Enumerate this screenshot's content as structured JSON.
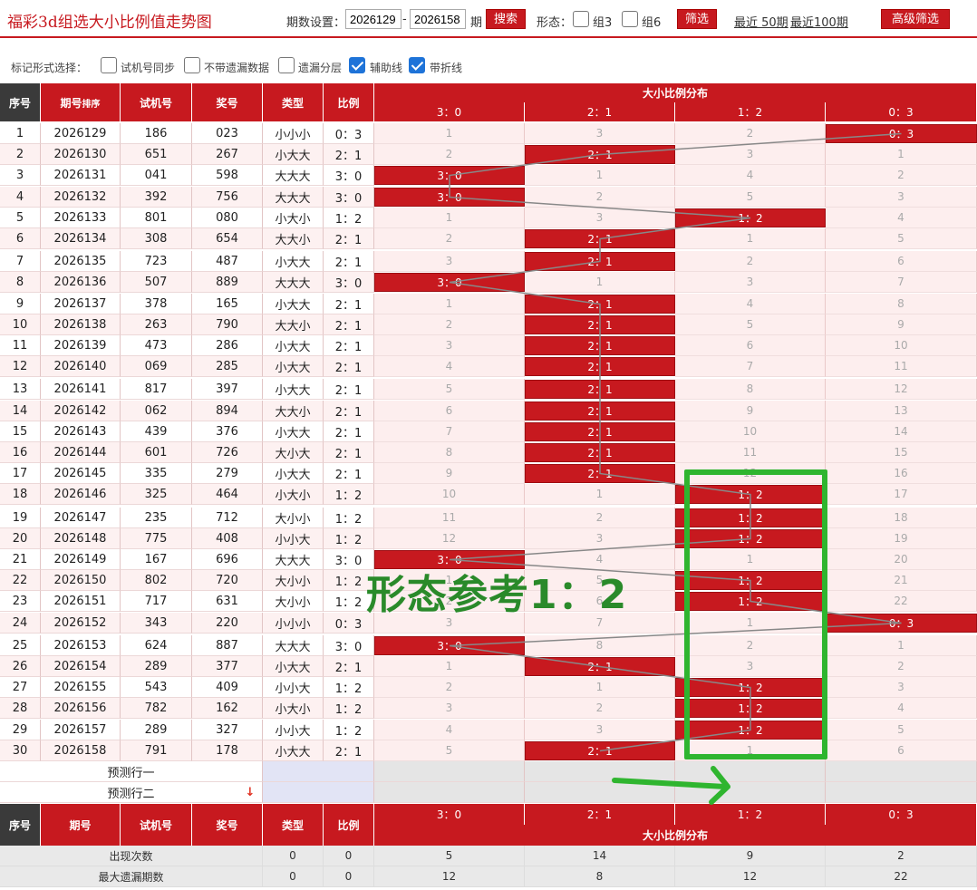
{
  "header": {
    "title": "福彩3d组选大小比例值走势图",
    "period_label": "期数设置：",
    "from": "2026129",
    "dash": "-",
    "to": "2026158",
    "period_unit": "期",
    "search_btn": "搜索",
    "shape_label": "形态：",
    "group3": "组3",
    "group6": "组6",
    "filter_btn": "筛选",
    "recent50": "最近 50期",
    "recent100": "最近100期",
    "advanced_btn": "高级筛选"
  },
  "markbar": {
    "label": "标记形式选择：",
    "opt1": "试机号同步",
    "opt2": "不带遗漏数据",
    "opt3": "遗漏分层",
    "opt4": "辅助线",
    "opt5": "带折线"
  },
  "table": {
    "headers": {
      "seq": "序号",
      "issue": "期号",
      "sort": "排序",
      "test": "试机号",
      "prize": "奖号",
      "type": "类型",
      "ratio": "比例",
      "dist": "大小比例分布"
    },
    "dist_cols": [
      "3：0",
      "2：1",
      "1：2",
      "0：3"
    ],
    "rows": [
      {
        "seq": "1",
        "issue": "2026129",
        "test": "186",
        "prize": "023",
        "type": "小小小",
        "ratio": "0：3",
        "hit": 3,
        "miss": [
          "1",
          "3",
          "2",
          ""
        ]
      },
      {
        "seq": "2",
        "issue": "2026130",
        "test": "651",
        "prize": "267",
        "type": "小大大",
        "ratio": "2：1",
        "hit": 1,
        "miss": [
          "2",
          "",
          "3",
          "1"
        ]
      },
      {
        "seq": "3",
        "issue": "2026131",
        "test": "041",
        "prize": "598",
        "type": "大大大",
        "ratio": "3：0",
        "hit": 0,
        "miss": [
          "",
          "1",
          "4",
          "2"
        ]
      },
      {
        "seq": "4",
        "issue": "2026132",
        "test": "392",
        "prize": "756",
        "type": "大大大",
        "ratio": "3：0",
        "hit": 0,
        "miss": [
          "",
          "2",
          "5",
          "3"
        ]
      },
      {
        "seq": "5",
        "issue": "2026133",
        "test": "801",
        "prize": "080",
        "type": "小大小",
        "ratio": "1：2",
        "hit": 2,
        "miss": [
          "1",
          "3",
          "",
          "4"
        ]
      },
      {
        "seq": "6",
        "issue": "2026134",
        "test": "308",
        "prize": "654",
        "type": "大大小",
        "ratio": "2：1",
        "hit": 1,
        "miss": [
          "2",
          "",
          "1",
          "5"
        ]
      },
      {
        "seq": "7",
        "issue": "2026135",
        "test": "723",
        "prize": "487",
        "type": "小大大",
        "ratio": "2：1",
        "hit": 1,
        "miss": [
          "3",
          "",
          "2",
          "6"
        ]
      },
      {
        "seq": "8",
        "issue": "2026136",
        "test": "507",
        "prize": "889",
        "type": "大大大",
        "ratio": "3：0",
        "hit": 0,
        "miss": [
          "",
          "1",
          "3",
          "7"
        ]
      },
      {
        "seq": "9",
        "issue": "2026137",
        "test": "378",
        "prize": "165",
        "type": "小大大",
        "ratio": "2：1",
        "hit": 1,
        "miss": [
          "1",
          "",
          "4",
          "8"
        ]
      },
      {
        "seq": "10",
        "issue": "2026138",
        "test": "263",
        "prize": "790",
        "type": "大大小",
        "ratio": "2：1",
        "hit": 1,
        "miss": [
          "2",
          "",
          "5",
          "9"
        ]
      },
      {
        "seq": "11",
        "issue": "2026139",
        "test": "473",
        "prize": "286",
        "type": "小大大",
        "ratio": "2：1",
        "hit": 1,
        "miss": [
          "3",
          "",
          "6",
          "10"
        ]
      },
      {
        "seq": "12",
        "issue": "2026140",
        "test": "069",
        "prize": "285",
        "type": "小大大",
        "ratio": "2：1",
        "hit": 1,
        "miss": [
          "4",
          "",
          "7",
          "11"
        ]
      },
      {
        "seq": "13",
        "issue": "2026141",
        "test": "817",
        "prize": "397",
        "type": "小大大",
        "ratio": "2：1",
        "hit": 1,
        "miss": [
          "5",
          "",
          "8",
          "12"
        ]
      },
      {
        "seq": "14",
        "issue": "2026142",
        "test": "062",
        "prize": "894",
        "type": "大大小",
        "ratio": "2：1",
        "hit": 1,
        "miss": [
          "6",
          "",
          "9",
          "13"
        ]
      },
      {
        "seq": "15",
        "issue": "2026143",
        "test": "439",
        "prize": "376",
        "type": "小大大",
        "ratio": "2：1",
        "hit": 1,
        "miss": [
          "7",
          "",
          "10",
          "14"
        ]
      },
      {
        "seq": "16",
        "issue": "2026144",
        "test": "601",
        "prize": "726",
        "type": "大小大",
        "ratio": "2：1",
        "hit": 1,
        "miss": [
          "8",
          "",
          "11",
          "15"
        ]
      },
      {
        "seq": "17",
        "issue": "2026145",
        "test": "335",
        "prize": "279",
        "type": "小大大",
        "ratio": "2：1",
        "hit": 1,
        "miss": [
          "9",
          "",
          "12",
          "16"
        ]
      },
      {
        "seq": "18",
        "issue": "2026146",
        "test": "325",
        "prize": "464",
        "type": "小大小",
        "ratio": "1：2",
        "hit": 2,
        "miss": [
          "10",
          "1",
          "",
          "17"
        ]
      },
      {
        "seq": "19",
        "issue": "2026147",
        "test": "235",
        "prize": "712",
        "type": "大小小",
        "ratio": "1：2",
        "hit": 2,
        "miss": [
          "11",
          "2",
          "",
          "18"
        ]
      },
      {
        "seq": "20",
        "issue": "2026148",
        "test": "775",
        "prize": "408",
        "type": "小小大",
        "ratio": "1：2",
        "hit": 2,
        "miss": [
          "12",
          "3",
          "",
          "19"
        ]
      },
      {
        "seq": "21",
        "issue": "2026149",
        "test": "167",
        "prize": "696",
        "type": "大大大",
        "ratio": "3：0",
        "hit": 0,
        "miss": [
          "",
          "4",
          "1",
          "20"
        ]
      },
      {
        "seq": "22",
        "issue": "2026150",
        "test": "802",
        "prize": "720",
        "type": "大小小",
        "ratio": "1：2",
        "hit": 2,
        "miss": [
          "1",
          "5",
          "",
          "21"
        ]
      },
      {
        "seq": "23",
        "issue": "2026151",
        "test": "717",
        "prize": "631",
        "type": "大小小",
        "ratio": "1：2",
        "hit": 2,
        "miss": [
          "2",
          "6",
          "",
          "22"
        ]
      },
      {
        "seq": "24",
        "issue": "2026152",
        "test": "343",
        "prize": "220",
        "type": "小小小",
        "ratio": "0：3",
        "hit": 3,
        "miss": [
          "3",
          "7",
          "1",
          ""
        ]
      },
      {
        "seq": "25",
        "issue": "2026153",
        "test": "624",
        "prize": "887",
        "type": "大大大",
        "ratio": "3：0",
        "hit": 0,
        "miss": [
          "",
          "8",
          "2",
          "1"
        ]
      },
      {
        "seq": "26",
        "issue": "2026154",
        "test": "289",
        "prize": "377",
        "type": "小大大",
        "ratio": "2：1",
        "hit": 1,
        "miss": [
          "1",
          "",
          "3",
          "2"
        ]
      },
      {
        "seq": "27",
        "issue": "2026155",
        "test": "543",
        "prize": "409",
        "type": "小小大",
        "ratio": "1：2",
        "hit": 2,
        "miss": [
          "2",
          "1",
          "",
          "3"
        ]
      },
      {
        "seq": "28",
        "issue": "2026156",
        "test": "782",
        "prize": "162",
        "type": "小大小",
        "ratio": "1：2",
        "hit": 2,
        "miss": [
          "3",
          "2",
          "",
          "4"
        ]
      },
      {
        "seq": "29",
        "issue": "2026157",
        "test": "289",
        "prize": "327",
        "type": "小小大",
        "ratio": "1：2",
        "hit": 2,
        "miss": [
          "4",
          "3",
          "",
          "5"
        ]
      },
      {
        "seq": "30",
        "issue": "2026158",
        "test": "791",
        "prize": "178",
        "type": "小大大",
        "ratio": "2：1",
        "hit": 1,
        "miss": [
          "5",
          "",
          "1",
          "6"
        ]
      }
    ],
    "predict1": "预测行一",
    "predict2": "预测行二",
    "stats": [
      {
        "label": "出现次数",
        "type": "0",
        "ratio": "0",
        "vals": [
          "5",
          "14",
          "9",
          "2"
        ]
      },
      {
        "label": "最大遗漏期数",
        "type": "0",
        "ratio": "0",
        "vals": [
          "12",
          "8",
          "12",
          "22"
        ]
      }
    ]
  },
  "annotation": "形态参考1：2",
  "colors": {
    "accent": "#c7191f",
    "annotation": "#2a8a2a",
    "box": "#2fb52f"
  }
}
